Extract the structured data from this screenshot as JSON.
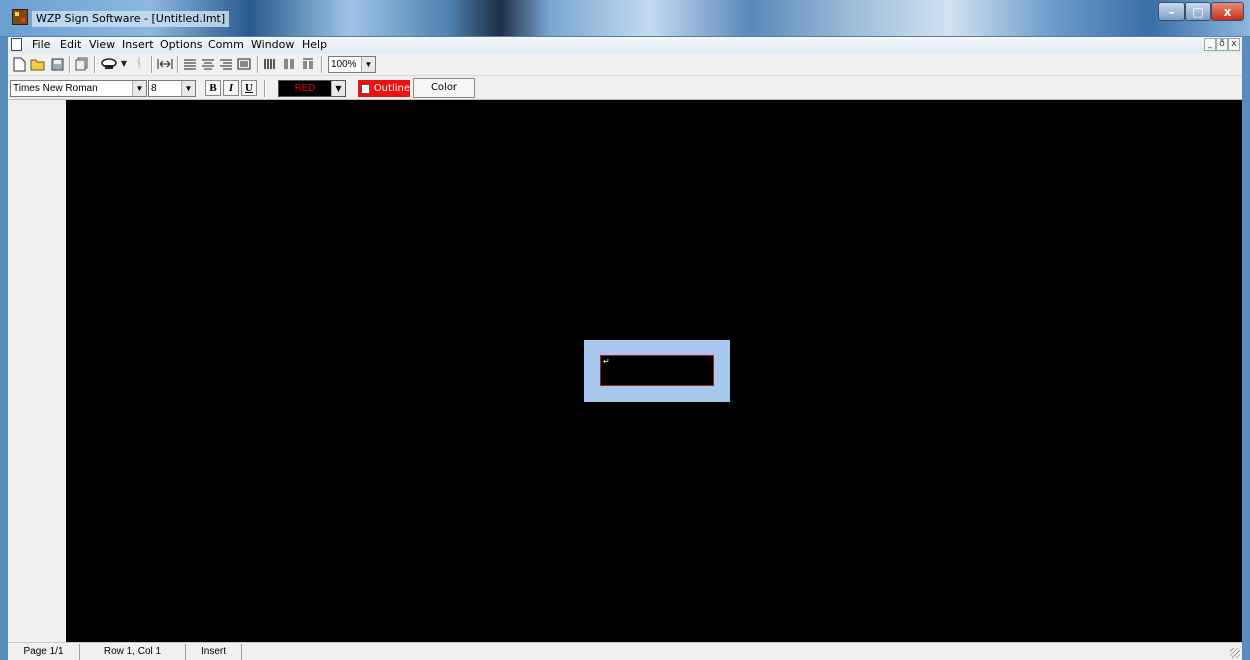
{
  "window": {
    "title": "WZP Sign Software - [Untitled.lmt]",
    "controls": {
      "minimize": "–",
      "maximize": "□",
      "close": "x"
    }
  },
  "menubar": {
    "items": [
      "File",
      "Edit",
      "View",
      "Insert",
      "Options",
      "Comm",
      "Window",
      "Help"
    ],
    "mdi_controls": [
      "_",
      "ð",
      "x"
    ]
  },
  "toolbar1": {
    "icons": [
      "new-document-icon",
      "open-folder-icon",
      "save-icon",
      "copy-page-icon",
      "phone-send-icon",
      "dropdown-arrow-icon",
      "tools-icon",
      "fit-width-icon",
      "align-left-icon",
      "align-center-icon",
      "align-right-icon",
      "justify-icon",
      "bars-wide-icon",
      "bars-medium-icon",
      "bars-narrow-icon"
    ],
    "zoom": "100%"
  },
  "toolbar2": {
    "font_family": "Times New Roman",
    "font_size": "8",
    "bold_label": "B",
    "italic_label": "I",
    "underline_label": "U",
    "text_color": "RED",
    "outline_label": "Outline",
    "color_button": "Color",
    "colors": {
      "red": "#e00000",
      "outline_bg": "#ef1111"
    }
  },
  "canvas": {
    "background": "#000000",
    "caret_glyph": "↵",
    "frame_color": "#a7c8ec"
  },
  "statusbar": {
    "page": "Page 1/1",
    "position": "Row 1, Col 1",
    "mode": "Insert"
  }
}
